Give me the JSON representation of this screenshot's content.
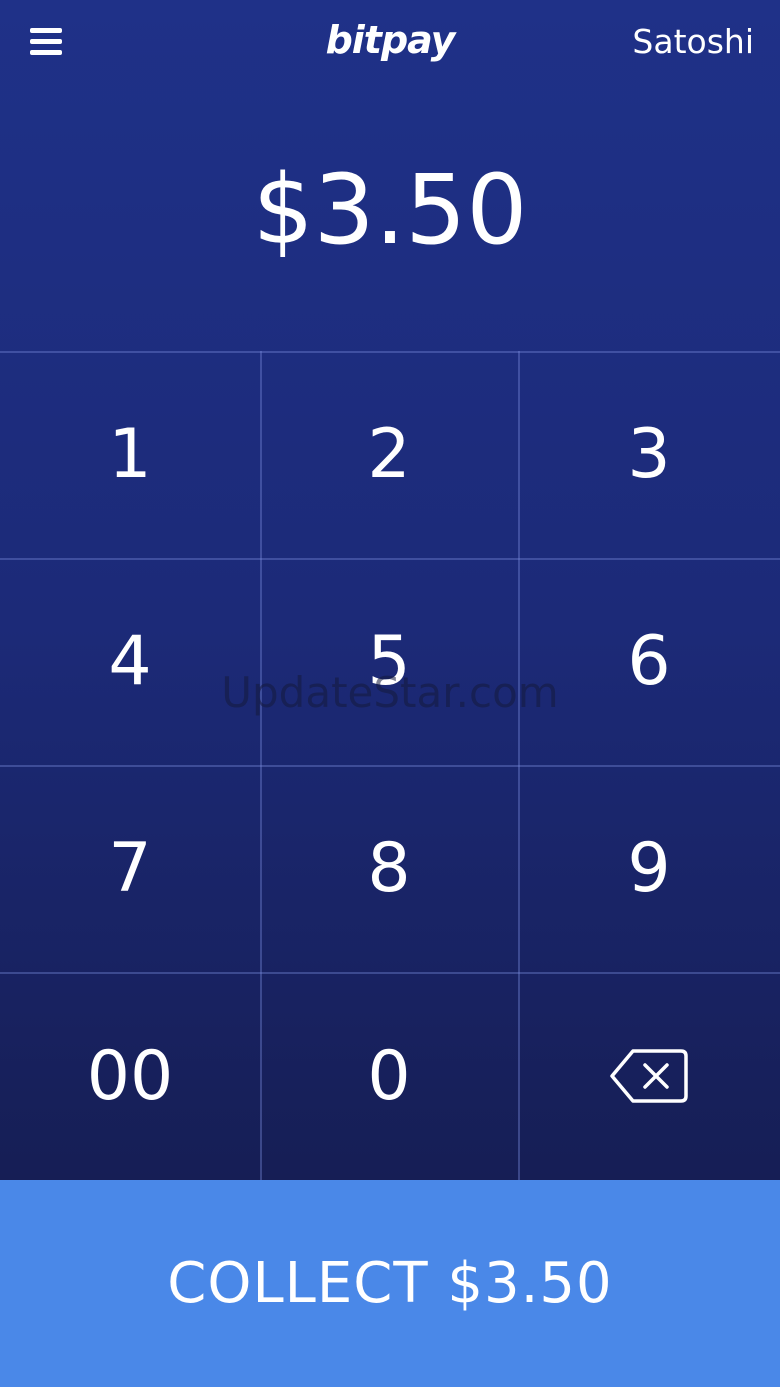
{
  "header": {
    "logo_text": "bitpay",
    "user_name": "Satoshi"
  },
  "amount_display": "$3.50",
  "keypad": {
    "keys": [
      "1",
      "2",
      "3",
      "4",
      "5",
      "6",
      "7",
      "8",
      "9",
      "00",
      "0"
    ],
    "backspace_icon": "backspace-icon"
  },
  "watermark": "UpdateStar.com",
  "collect_button": {
    "label": "COLLECT $3.50"
  },
  "colors": {
    "background_top": "#1f3188",
    "background_bottom": "#151c50",
    "collect_button": "#4a88e8",
    "text": "#ffffff"
  }
}
